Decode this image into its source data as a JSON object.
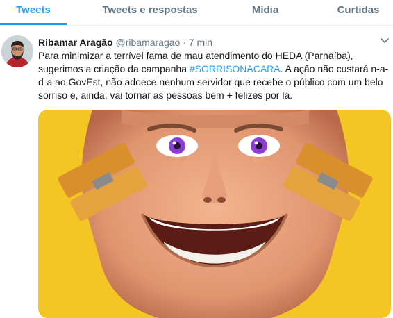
{
  "tabs": [
    {
      "label": "Tweets",
      "active": true
    },
    {
      "label": "Tweets e respostas",
      "active": false
    },
    {
      "label": "Mídia",
      "active": false
    },
    {
      "label": "Curtidas",
      "active": false
    }
  ],
  "tweet": {
    "name": "Ribamar Aragão",
    "handle": "@ribamaragao",
    "separator": "·",
    "time": "7 min",
    "text_part1": "Para minimizar a terrível fama de mau atendimento do HEDA (Parnaíba), sugerimos a criação da campanha ",
    "hashtag": "#SORRISONACARA",
    "text_part2": ". A ação não custará n-a-d-a ao GovEst, não adoece nenhum servidor que recebe o público com um belo sorriso e, ainda, vai tornar as pessoas bem + felizes por lá."
  },
  "colors": {
    "accent": "#1da1f2",
    "secondary_text": "#657786",
    "image_background": "#f3c623"
  },
  "icons": {
    "caret": "chevron-down-icon"
  }
}
